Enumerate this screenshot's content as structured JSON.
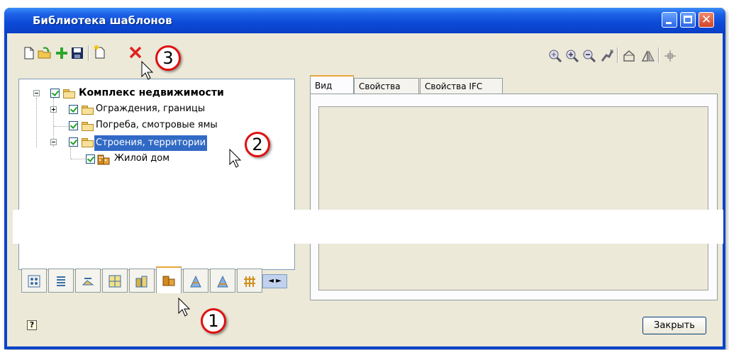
{
  "window": {
    "title": "Библиотека шаблонов",
    "controls": [
      "minimize",
      "maximize",
      "close"
    ]
  },
  "toolbar": {
    "left_icons": [
      "new-icon",
      "open-icon",
      "add-icon",
      "save-icon",
      "new-template-icon",
      "delete-icon"
    ],
    "right_icons": [
      "zoom-fit-icon",
      "zoom-in-icon",
      "zoom-out-icon",
      "pan-icon",
      "rotate-3d-icon",
      "mirror-icon",
      "center-icon"
    ]
  },
  "tree": {
    "root": "Комплекс недвижимости",
    "children": [
      {
        "label": "Ограждения, границы"
      },
      {
        "label": "Погреба, смотровые ямы"
      },
      {
        "label": "Строения, территории"
      }
    ],
    "leaf": "Жилой дом"
  },
  "category_tabs": {
    "icons": [
      "points-icon",
      "list-icon",
      "area-icon",
      "map-icon",
      "buildings-icon",
      "house-icon",
      "tower-icon",
      "tower-alt-icon",
      "fence-icon"
    ],
    "active_index": 5,
    "scroll": "◄ ►"
  },
  "right_tabs": [
    "Вид",
    "Свойства",
    "Свойства IFC"
  ],
  "buttons": {
    "close": "Закрыть",
    "help": "?"
  },
  "callouts": [
    "1",
    "2",
    "3"
  ],
  "colors": {
    "title_bar": "#0a44c8",
    "selection": "#316ac5",
    "callout_border": "#e01010",
    "active_tab_accent": "#e9a53a"
  }
}
